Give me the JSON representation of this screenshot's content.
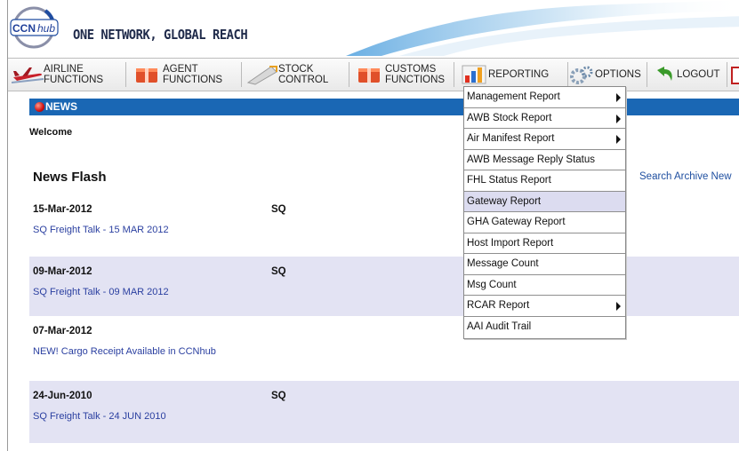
{
  "header": {
    "logo_text": "CCNhub",
    "slogan": "ONE NETWORK, GLOBAL REACH"
  },
  "nav": {
    "airline": [
      "AIRLINE",
      "FUNCTIONS"
    ],
    "agent": [
      "AGENT",
      "FUNCTIONS"
    ],
    "stock": [
      "STOCK",
      "CONTROL"
    ],
    "customs": [
      "CUSTOMS",
      "FUNCTIONS"
    ],
    "reporting": "REPORTING",
    "options": "OPTIONS",
    "logout": "LOGOUT"
  },
  "news": {
    "section_label": "NEWS",
    "welcome": "Welcome",
    "flash_title": "News Flash",
    "archive_link": "Search Archive New",
    "items": [
      {
        "date": "15-Mar-2012",
        "source": "SQ",
        "title": "SQ Freight Talk - 15 MAR 2012"
      },
      {
        "date": "09-Mar-2012",
        "source": "SQ",
        "title": "SQ Freight Talk - 09 MAR 2012"
      },
      {
        "date": "07-Mar-2012",
        "source": "",
        "title": "NEW! Cargo Receipt Available in CCNhub"
      },
      {
        "date": "24-Jun-2010",
        "source": "SQ",
        "title": "SQ Freight Talk - 24 JUN 2010"
      }
    ]
  },
  "reporting_menu": {
    "items": [
      {
        "label": "Management Report",
        "submenu": true
      },
      {
        "label": "AWB Stock Report",
        "submenu": true
      },
      {
        "label": "Air Manifest Report",
        "submenu": true
      },
      {
        "label": "AWB Message Reply Status",
        "submenu": false
      },
      {
        "label": "FHL Status Report",
        "submenu": false
      },
      {
        "label": "Gateway Report",
        "submenu": false,
        "highlighted": true
      },
      {
        "label": "GHA Gateway Report",
        "submenu": false
      },
      {
        "label": "Host Import Report",
        "submenu": false
      },
      {
        "label": "Message Count",
        "submenu": false
      },
      {
        "label": "Msg Count",
        "submenu": false
      },
      {
        "label": "RCAR Report",
        "submenu": true
      },
      {
        "label": "AAI Audit Trail",
        "submenu": false
      }
    ]
  },
  "colors": {
    "news_bar": "#1a67b4",
    "row_shade": "#e3e3f3",
    "link": "#2a3fa0"
  }
}
